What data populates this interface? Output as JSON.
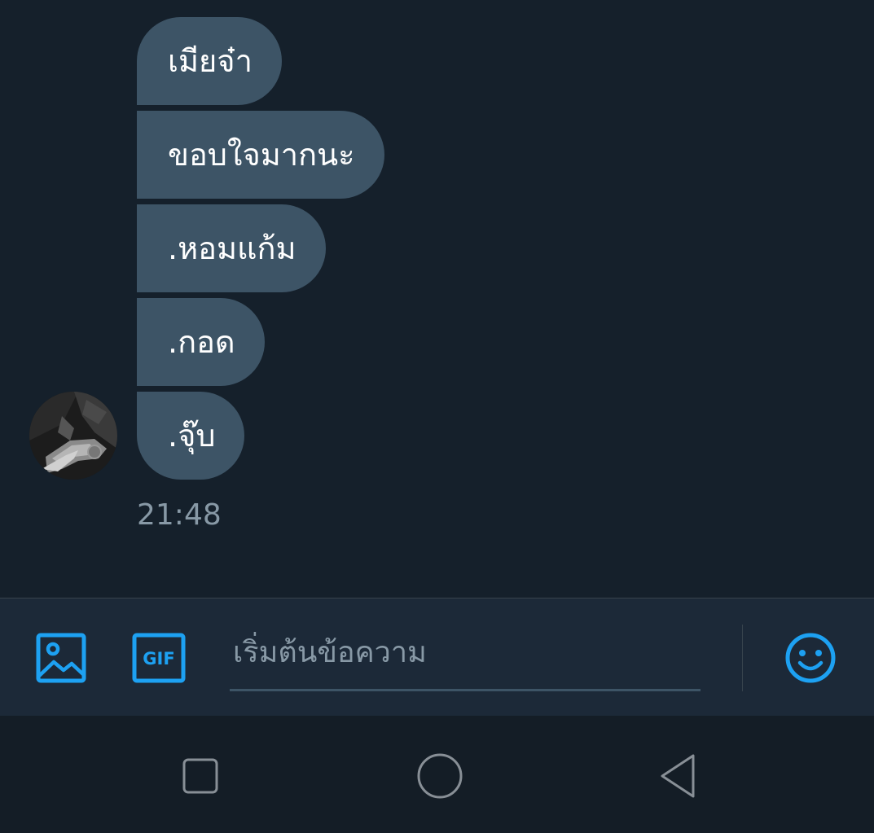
{
  "messages": [
    {
      "text": "เมียจ๋า"
    },
    {
      "text": "ขอบใจมากนะ"
    },
    {
      "text": ".หอมแก้ม"
    },
    {
      "text": ".กอด"
    },
    {
      "text": ".จุ๊บ"
    }
  ],
  "timestamp": "21:48",
  "composer": {
    "placeholder": "เริ่มต้นข้อความ",
    "value": "",
    "media_icon": "image-icon",
    "gif_icon": "gif-icon",
    "gif_label": "GIF",
    "emoji_icon": "smiley-icon"
  },
  "navbar": {
    "recent_icon": "square-icon",
    "home_icon": "circle-icon",
    "back_icon": "triangle-back-icon"
  },
  "colors": {
    "background": "#15202b",
    "bubble": "#3d5466",
    "accent": "#1da1f2",
    "muted_text": "#8899a6",
    "composer_bg": "#1c2938",
    "navbar_bg": "#141d26"
  }
}
